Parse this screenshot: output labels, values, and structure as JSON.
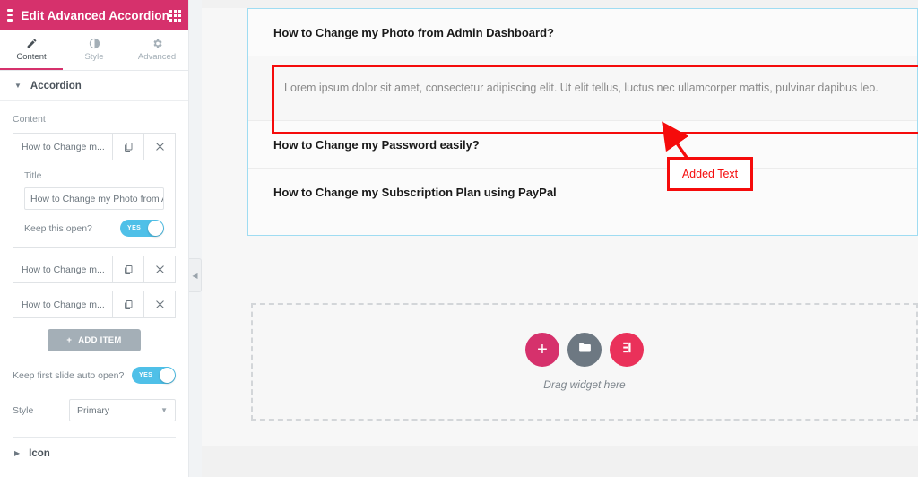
{
  "panel": {
    "header": {
      "title": "Edit Advanced Accordion",
      "menu_icon": "hamburger-icon",
      "apps_icon": "grid-apps-icon"
    },
    "tabs": [
      {
        "label": "Content",
        "icon": "pencil-icon",
        "active": true
      },
      {
        "label": "Style",
        "icon": "contrast-half-circle-icon",
        "active": false
      },
      {
        "label": "Advanced",
        "icon": "gear-icon",
        "active": false
      }
    ],
    "section": {
      "title": "Accordion",
      "caret": "caret-down"
    },
    "content_label": "Content",
    "repeater_items": [
      {
        "title": "How to Change m...",
        "duplicate_icon": "copy-icon",
        "remove_icon": "close-icon"
      },
      {
        "title": "How to Change m...",
        "duplicate_icon": "copy-icon",
        "remove_icon": "close-icon"
      },
      {
        "title": "How to Change m...",
        "duplicate_icon": "copy-icon",
        "remove_icon": "close-icon"
      }
    ],
    "item_editor": {
      "title_label": "Title",
      "title_value": "How to Change my Photo from A",
      "keep_open_label": "Keep this open?",
      "keep_open_value": "YES"
    },
    "add_item_label": "ADD ITEM",
    "add_item_icon": "plus-icon",
    "auto_open_label": "Keep first slide auto open?",
    "auto_open_value": "YES",
    "style_label": "Style",
    "style_value": "Primary",
    "icon_section_title": "Icon",
    "icon_section_caret": "caret-right",
    "collapse_handle_icon": "chevron-left-icon"
  },
  "canvas": {
    "accordion": [
      {
        "title": "How to Change my Photo from Admin Dashboard?",
        "open": true,
        "body": "Lorem ipsum dolor sit amet, consectetur adipiscing elit. Ut elit tellus, luctus nec ullamcorper mattis, pulvinar dapibus leo."
      },
      {
        "title": "How to Change my Password easily?",
        "open": false,
        "body": ""
      },
      {
        "title": "How to Change my Subscription Plan using PayPal",
        "open": false,
        "body": ""
      }
    ],
    "annotation": {
      "label": "Added Text",
      "color": "#f50b0b"
    },
    "drop_zone": {
      "text": "Drag widget here",
      "buttons": [
        {
          "name": "add-widget-button",
          "icon": "plus-icon",
          "color": "#d6316c"
        },
        {
          "name": "add-template-button",
          "icon": "folder-icon",
          "color": "#6d7882"
        },
        {
          "name": "elementor-logo-button",
          "icon": "elementor-icon",
          "color": "#ea315a"
        }
      ]
    }
  },
  "colors": {
    "brand_pink": "#d6316c",
    "toggle_blue": "#4fc0e8",
    "selection_border": "#9fdcf2",
    "annotation_red": "#f50b0b"
  }
}
